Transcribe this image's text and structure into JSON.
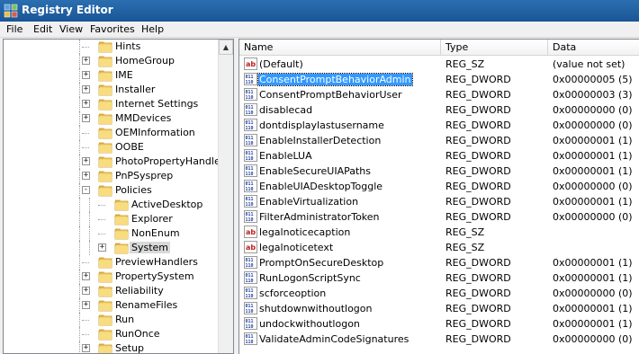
{
  "window": {
    "title": "Registry Editor"
  },
  "menu": [
    "File",
    "Edit",
    "View",
    "Favorites",
    "Help"
  ],
  "tree": [
    {
      "label": "Hints",
      "depth": 0,
      "expander": ""
    },
    {
      "label": "HomeGroup",
      "depth": 0,
      "expander": "+"
    },
    {
      "label": "IME",
      "depth": 0,
      "expander": "+"
    },
    {
      "label": "Installer",
      "depth": 0,
      "expander": "+"
    },
    {
      "label": "Internet Settings",
      "depth": 0,
      "expander": "+"
    },
    {
      "label": "MMDevices",
      "depth": 0,
      "expander": "+"
    },
    {
      "label": "OEMInformation",
      "depth": 0,
      "expander": ""
    },
    {
      "label": "OOBE",
      "depth": 0,
      "expander": ""
    },
    {
      "label": "PhotoPropertyHandler",
      "depth": 0,
      "expander": "+"
    },
    {
      "label": "PnPSysprep",
      "depth": 0,
      "expander": "+"
    },
    {
      "label": "Policies",
      "depth": 0,
      "expander": "-"
    },
    {
      "label": "ActiveDesktop",
      "depth": 1,
      "expander": ""
    },
    {
      "label": "Explorer",
      "depth": 1,
      "expander": ""
    },
    {
      "label": "NonEnum",
      "depth": 1,
      "expander": ""
    },
    {
      "label": "System",
      "depth": 1,
      "expander": "+",
      "selected": true
    },
    {
      "label": "PreviewHandlers",
      "depth": 0,
      "expander": ""
    },
    {
      "label": "PropertySystem",
      "depth": 0,
      "expander": "+"
    },
    {
      "label": "Reliability",
      "depth": 0,
      "expander": "+"
    },
    {
      "label": "RenameFiles",
      "depth": 0,
      "expander": "+"
    },
    {
      "label": "Run",
      "depth": 0,
      "expander": ""
    },
    {
      "label": "RunOnce",
      "depth": 0,
      "expander": ""
    },
    {
      "label": "Setup",
      "depth": 0,
      "expander": "+"
    }
  ],
  "columns": [
    "Name",
    "Type",
    "Data"
  ],
  "values": [
    {
      "name": "(Default)",
      "type": "REG_SZ",
      "data": "(value not set)",
      "icon": "string-icon"
    },
    {
      "name": "ConsentPromptBehaviorAdmin",
      "type": "REG_DWORD",
      "data": "0x00000005 (5)",
      "icon": "binary-icon",
      "selected": true
    },
    {
      "name": "ConsentPromptBehaviorUser",
      "type": "REG_DWORD",
      "data": "0x00000003 (3)",
      "icon": "binary-icon"
    },
    {
      "name": "disablecad",
      "type": "REG_DWORD",
      "data": "0x00000000 (0)",
      "icon": "binary-icon"
    },
    {
      "name": "dontdisplaylastusername",
      "type": "REG_DWORD",
      "data": "0x00000000 (0)",
      "icon": "binary-icon"
    },
    {
      "name": "EnableInstallerDetection",
      "type": "REG_DWORD",
      "data": "0x00000001 (1)",
      "icon": "binary-icon"
    },
    {
      "name": "EnableLUA",
      "type": "REG_DWORD",
      "data": "0x00000001 (1)",
      "icon": "binary-icon"
    },
    {
      "name": "EnableSecureUIAPaths",
      "type": "REG_DWORD",
      "data": "0x00000001 (1)",
      "icon": "binary-icon"
    },
    {
      "name": "EnableUIADesktopToggle",
      "type": "REG_DWORD",
      "data": "0x00000000 (0)",
      "icon": "binary-icon"
    },
    {
      "name": "EnableVirtualization",
      "type": "REG_DWORD",
      "data": "0x00000001 (1)",
      "icon": "binary-icon"
    },
    {
      "name": "FilterAdministratorToken",
      "type": "REG_DWORD",
      "data": "0x00000000 (0)",
      "icon": "binary-icon"
    },
    {
      "name": "legalnoticecaption",
      "type": "REG_SZ",
      "data": "",
      "icon": "string-icon"
    },
    {
      "name": "legalnoticetext",
      "type": "REG_SZ",
      "data": "",
      "icon": "string-icon"
    },
    {
      "name": "PromptOnSecureDesktop",
      "type": "REG_DWORD",
      "data": "0x00000001 (1)",
      "icon": "binary-icon"
    },
    {
      "name": "RunLogonScriptSync",
      "type": "REG_DWORD",
      "data": "0x00000001 (1)",
      "icon": "binary-icon"
    },
    {
      "name": "scforceoption",
      "type": "REG_DWORD",
      "data": "0x00000000 (0)",
      "icon": "binary-icon"
    },
    {
      "name": "shutdownwithoutlogon",
      "type": "REG_DWORD",
      "data": "0x00000001 (1)",
      "icon": "binary-icon"
    },
    {
      "name": "undockwithoutlogon",
      "type": "REG_DWORD",
      "data": "0x00000001 (1)",
      "icon": "binary-icon"
    },
    {
      "name": "ValidateAdminCodeSignatures",
      "type": "REG_DWORD",
      "data": "0x00000000 (0)",
      "icon": "binary-icon"
    }
  ]
}
